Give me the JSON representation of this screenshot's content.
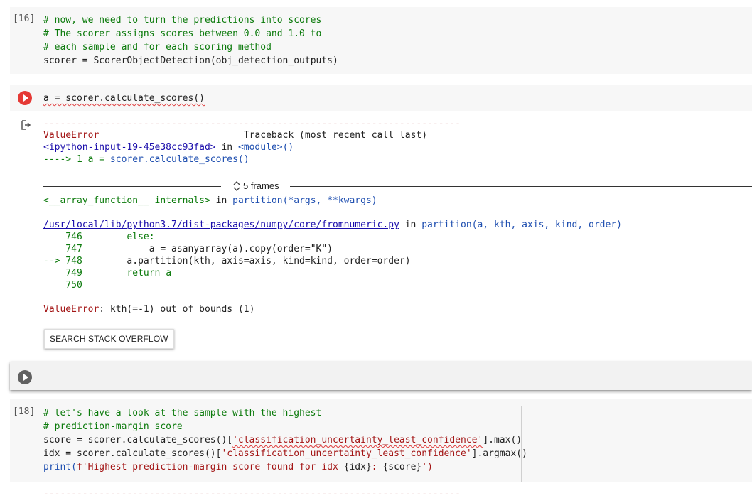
{
  "cells": {
    "c16": {
      "prompt": "[16]",
      "lines": [
        "# now, we need to turn the predictions into scores",
        "# The scorer assigns scores between 0.0 and 1.0 to",
        "# each sample and for each scoring method"
      ],
      "code_var": "scorer",
      "code_eq": " = ",
      "code_call": "ScorerObjectDetection(obj_detection_outputs)"
    },
    "c19": {
      "code": "a = scorer.calculate_scores()"
    },
    "error": {
      "dashes": "---------------------------------------------------------------------------",
      "err_name": "ValueError",
      "traceback_header": "                          Traceback (most recent call last)",
      "link1": "<ipython-input-19-45e38cc93fad>",
      "in_text": " in ",
      "module": "<module>()",
      "arrow_line_prefix": "----> 1 a = ",
      "arrow_line_call": "scorer.calculate_scores()",
      "frames_label": "5 frames",
      "internals_prefix": "<__array_function__ internals>",
      "partition_call": "partition(*args, **kwargs)",
      "numpy_path": "/usr/local/lib/python3.7/dist-packages/numpy/core/fromnumeric.py",
      "partition_sig": "partition(a, kth, axis, kind, order)",
      "source_lines": [
        {
          "num": "    746",
          "code": "        else:"
        },
        {
          "num": "    747",
          "code": "            a = asanyarray(a).copy(order=\"K\")"
        },
        {
          "num": "--> 748",
          "code": "        a.partition(kth, axis=axis, kind=kind, order=order)"
        },
        {
          "num": "    749",
          "code": "        return a"
        },
        {
          "num": "    750",
          "code": ""
        }
      ],
      "final_error_name": "ValueError",
      "final_error_msg": ": kth(=-1) out of bounds (1)",
      "so_button": "SEARCH STACK OVERFLOW"
    },
    "c18": {
      "prompt": "[18]",
      "lines": [
        "# let's have a look at the sample with the highest",
        "# prediction-margin score"
      ],
      "score_line_a": "score = scorer.calculate_scores()[",
      "score_line_str": "'classification_uncertainty_least_confidence'",
      "score_line_b": "].max()",
      "idx_line_a": "idx = scorer.calculate_scores()[",
      "idx_line_str": "'classification_uncertainty_least_confidence'",
      "idx_line_b": "].argmax()",
      "print_a": "print(",
      "print_f": "f'Highest prediction-margin score found for idx ",
      "print_idx": "{idx}",
      "print_mid": ": ",
      "print_score": "{score}",
      "print_end": "')",
      "dashes2": "---------------------------------------------------------------------------"
    }
  },
  "colors": {
    "run_red": "#e53935",
    "run_gray": "#616161"
  }
}
